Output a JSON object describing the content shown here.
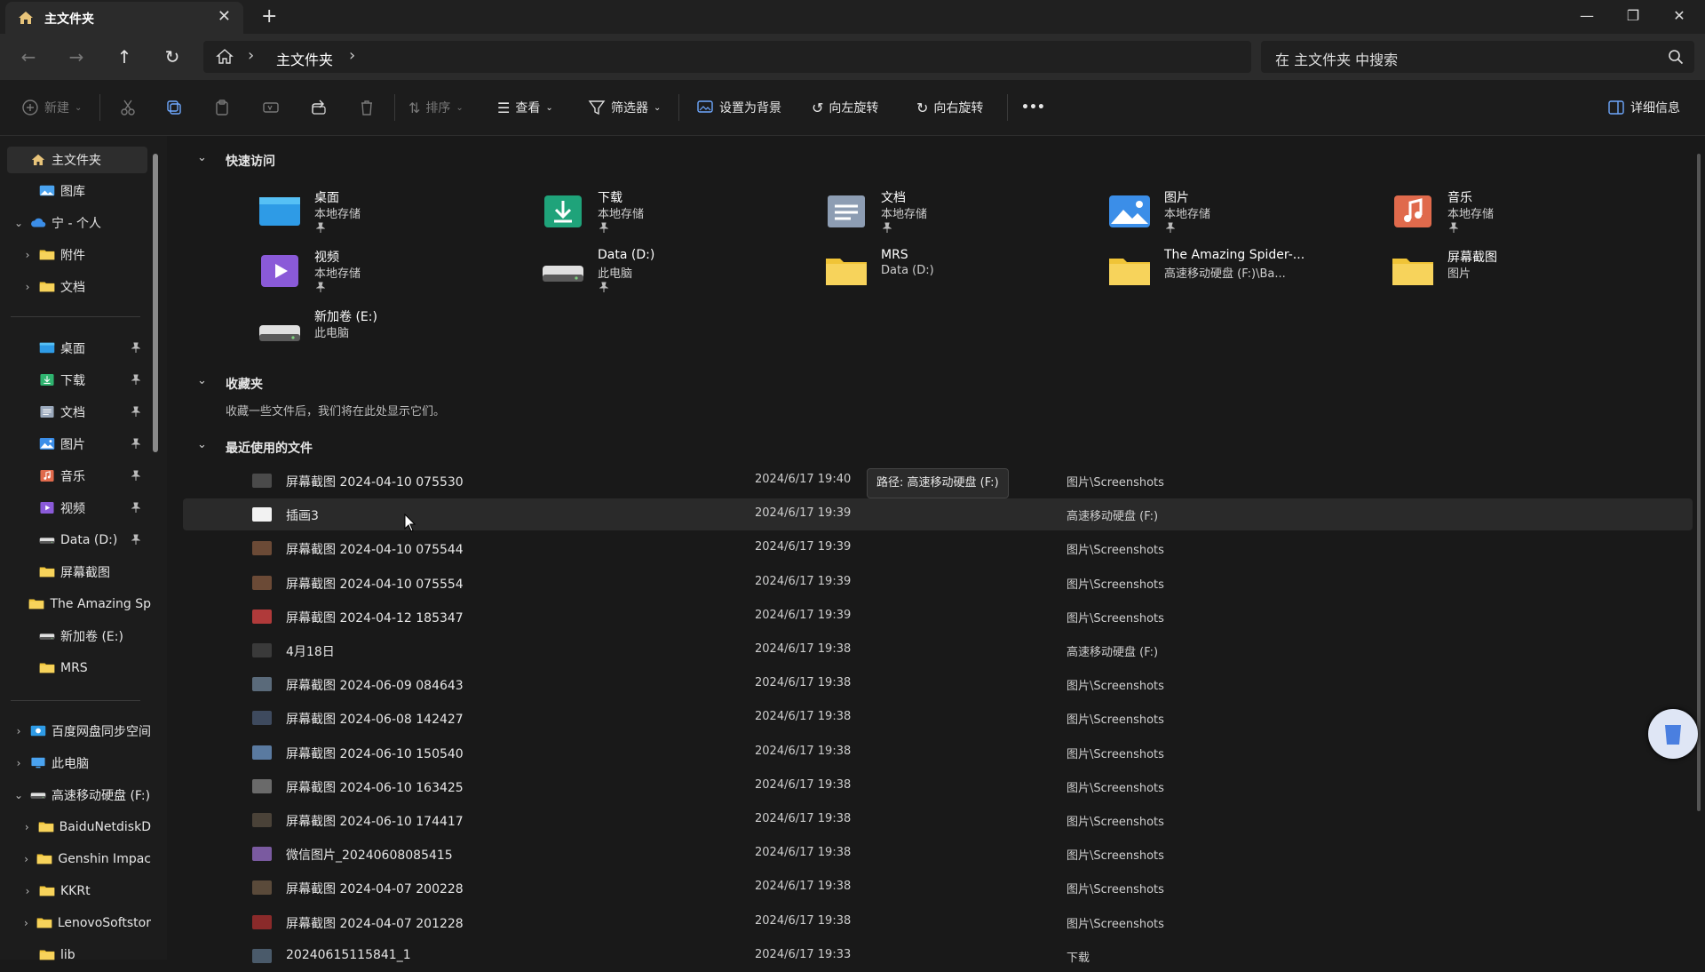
{
  "window": {
    "tab_title": "主文件夹",
    "tab_close": "✕",
    "new_tab": "+",
    "minimize": "—",
    "restore": "❐",
    "close": "✕"
  },
  "nav": {
    "back": "←",
    "forward": "→",
    "up": "↑",
    "refresh": "↻",
    "breadcrumb": [
      "主文件夹"
    ],
    "separator": "›",
    "search_placeholder": "在 主文件夹 中搜索"
  },
  "toolbar": {
    "new_label": "新建",
    "sort_label": "排序",
    "view_label": "查看",
    "filter_label": "筛选器",
    "set_background_label": "设置为背景",
    "rotate_left_label": "向左旋转",
    "rotate_right_label": "向右旋转",
    "more_label": "•••",
    "details_label": "详细信息"
  },
  "sidebar": {
    "items": [
      {
        "label": "主文件夹",
        "icon": "home-icon",
        "color": "#e8c47a"
      },
      {
        "label": "图库",
        "icon": "gallery-icon",
        "color": "#4aa3f0"
      },
      {
        "label": "宁 - 个人",
        "icon": "cloud-icon",
        "color": "#3b8ee8",
        "chevron": "⌄"
      },
      {
        "label": "附件",
        "icon": "folder-icon",
        "color": "#f0c437",
        "chevron": "›"
      },
      {
        "label": "文档",
        "icon": "folder-icon",
        "color": "#f0c437",
        "chevron": "›"
      },
      {
        "label": "桌面",
        "icon": "desktop-icon",
        "color": "#2e9be6",
        "pinned": true
      },
      {
        "label": "下载",
        "icon": "download-icon",
        "color": "#2fb36f",
        "pinned": true
      },
      {
        "label": "文档",
        "icon": "documents-icon",
        "color": "#9aa8bb",
        "pinned": true
      },
      {
        "label": "图片",
        "icon": "pictures-icon",
        "color": "#3b8ee8",
        "pinned": true
      },
      {
        "label": "音乐",
        "icon": "music-icon",
        "color": "#e06a4c",
        "pinned": true
      },
      {
        "label": "视频",
        "icon": "video-icon",
        "color": "#8a5ad8",
        "pinned": true
      },
      {
        "label": "Data (D:)",
        "icon": "drive-icon",
        "color": "#aaaaaa",
        "pinned": true
      },
      {
        "label": "屏幕截图",
        "icon": "folder-icon",
        "color": "#f0c437"
      },
      {
        "label": "The Amazing Sp",
        "icon": "folder-icon",
        "color": "#f0c437"
      },
      {
        "label": "新加卷 (E:)",
        "icon": "drive-icon",
        "color": "#aaaaaa"
      },
      {
        "label": "MRS",
        "icon": "folder-icon",
        "color": "#f0c437"
      },
      {
        "label": "百度网盘同步空间",
        "icon": "baidu-icon",
        "color": "#2e9be6",
        "chevron": "›"
      },
      {
        "label": "此电脑",
        "icon": "pc-icon",
        "color": "#4aa3f0",
        "chevron": "›"
      },
      {
        "label": "高速移动硬盘 (F:)",
        "icon": "drive-icon",
        "color": "#aaaaaa",
        "chevron": "⌄"
      },
      {
        "label": "BaiduNetdiskD",
        "icon": "folder-icon",
        "color": "#f0c437",
        "chevron": "›"
      },
      {
        "label": "Genshin Impac",
        "icon": "folder-icon",
        "color": "#f0c437",
        "chevron": "›"
      },
      {
        "label": "KKRt",
        "icon": "folder-icon",
        "color": "#f0c437",
        "chevron": "›"
      },
      {
        "label": "LenovoSoftstor",
        "icon": "folder-icon",
        "color": "#f0c437",
        "chevron": "›"
      },
      {
        "label": "lib",
        "icon": "folder-icon",
        "color": "#f0c437"
      }
    ]
  },
  "quick_access": {
    "title": "快速访问",
    "items": [
      {
        "name": "桌面",
        "sub": "本地存储",
        "icon": "desktop-icon",
        "color": "#2e9be6",
        "pinned": true
      },
      {
        "name": "下载",
        "sub": "本地存储",
        "icon": "download-icon",
        "color": "#1fa37a",
        "pinned": true
      },
      {
        "name": "文档",
        "sub": "本地存储",
        "icon": "documents-icon",
        "color": "#8d9db3",
        "pinned": true
      },
      {
        "name": "图片",
        "sub": "本地存储",
        "icon": "pictures-icon",
        "color": "#3b8ee8",
        "pinned": true
      },
      {
        "name": "音乐",
        "sub": "本地存储",
        "icon": "music-icon",
        "color": "#e06a4c",
        "pinned": true
      },
      {
        "name": "视频",
        "sub": "本地存储",
        "icon": "video-icon",
        "color": "#8a5ad8",
        "pinned": true
      },
      {
        "name": "Data (D:)",
        "sub": "此电脑",
        "icon": "drive-icon",
        "color": "#9a9a9a",
        "pinned": true
      },
      {
        "name": "MRS",
        "sub": "Data (D:)",
        "icon": "folder-icon",
        "color": "#f0c437",
        "pinned": false
      },
      {
        "name": "The Amazing Spider-...",
        "sub": "高速移动硬盘 (F:)\\Ba...",
        "icon": "folder-icon",
        "color": "#f0c437",
        "pinned": false
      },
      {
        "name": "屏幕截图",
        "sub": "图片",
        "icon": "folder-icon",
        "color": "#f0c437",
        "pinned": false
      },
      {
        "name": "新加卷 (E:)",
        "sub": "此电脑",
        "icon": "drive-icon",
        "color": "#9a9a9a",
        "pinned": false
      }
    ]
  },
  "favorites": {
    "title": "收藏夹",
    "empty_text": "收藏一些文件后，我们将在此处显示它们。"
  },
  "recent": {
    "title": "最近使用的文件",
    "tooltip": "路径: 高速移动硬盘 (F:)",
    "files": [
      {
        "name": "屏幕截图 2024-04-10 075530",
        "date": "2024/6/17 19:40",
        "location": "图片\\Screenshots",
        "thumb": "#4a4a4a"
      },
      {
        "name": "插画3",
        "date": "2024/6/17 19:39",
        "location": "高速移动硬盘 (F:)",
        "thumb": "#f2f2f2"
      },
      {
        "name": "屏幕截图 2024-04-10 075544",
        "date": "2024/6/17 19:39",
        "location": "图片\\Screenshots",
        "thumb": "#6b4a36"
      },
      {
        "name": "屏幕截图 2024-04-10 075554",
        "date": "2024/6/17 19:39",
        "location": "图片\\Screenshots",
        "thumb": "#6b4a36"
      },
      {
        "name": "屏幕截图 2024-04-12 185347",
        "date": "2024/6/17 19:39",
        "location": "图片\\Screenshots",
        "thumb": "#b03a3a"
      },
      {
        "name": "4月18日",
        "date": "2024/6/17 19:38",
        "location": "高速移动硬盘 (F:)",
        "thumb": "#3a3a3a"
      },
      {
        "name": "屏幕截图 2024-06-09 084643",
        "date": "2024/6/17 19:38",
        "location": "图片\\Screenshots",
        "thumb": "#5a6a7a"
      },
      {
        "name": "屏幕截图 2024-06-08 142427",
        "date": "2024/6/17 19:38",
        "location": "图片\\Screenshots",
        "thumb": "#3e4a5e"
      },
      {
        "name": "屏幕截图 2024-06-10 150540",
        "date": "2024/6/17 19:38",
        "location": "图片\\Screenshots",
        "thumb": "#5a7aa0"
      },
      {
        "name": "屏幕截图 2024-06-10 163425",
        "date": "2024/6/17 19:38",
        "location": "图片\\Screenshots",
        "thumb": "#6a6a6a"
      },
      {
        "name": "屏幕截图 2024-06-10 174417",
        "date": "2024/6/17 19:38",
        "location": "图片\\Screenshots",
        "thumb": "#4a4238"
      },
      {
        "name": "微信图片_20240608085415",
        "date": "2024/6/17 19:38",
        "location": "图片\\Screenshots",
        "thumb": "#7a5aa0"
      },
      {
        "name": "屏幕截图 2024-04-07 200228",
        "date": "2024/6/17 19:38",
        "location": "图片\\Screenshots",
        "thumb": "#5a4a3a"
      },
      {
        "name": "屏幕截图 2024-04-07 201228",
        "date": "2024/6/17 19:38",
        "location": "图片\\Screenshots",
        "thumb": "#8a2a2a"
      },
      {
        "name": "20240615115841_1",
        "date": "2024/6/17 19:33",
        "location": "下载",
        "thumb": "#4a5a6a"
      }
    ]
  }
}
